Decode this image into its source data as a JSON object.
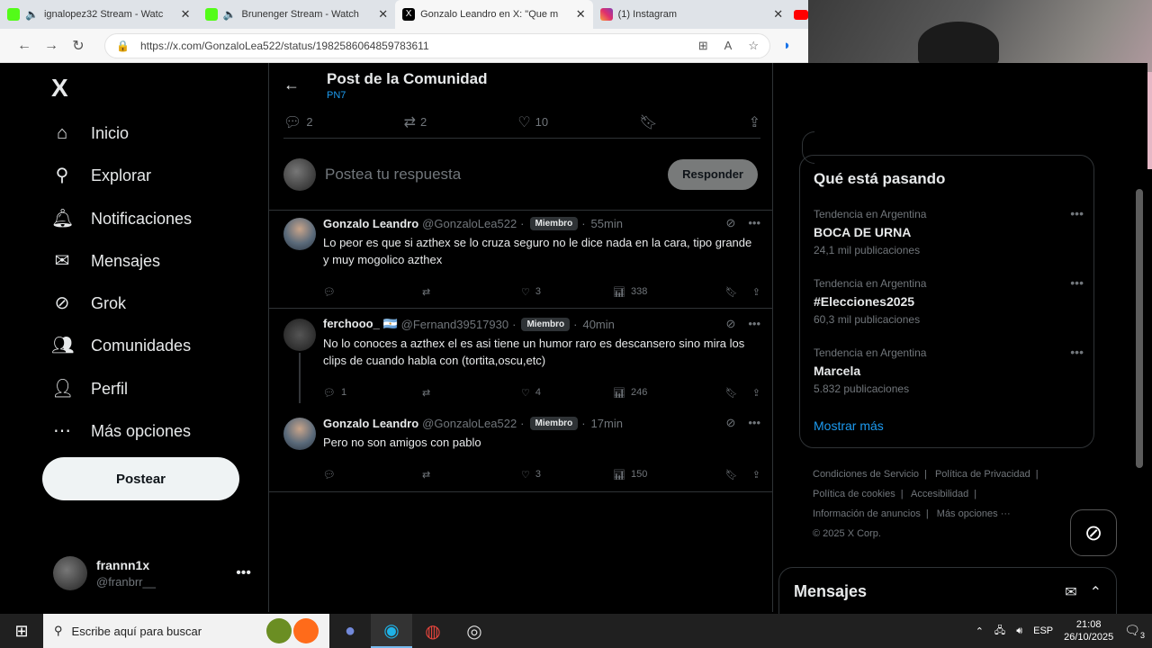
{
  "browser": {
    "tabs": [
      {
        "title": "ignalopez32 Stream - Watc",
        "favicon_color": "#53fc18",
        "muted": true
      },
      {
        "title": "Brunenger Stream - Watch",
        "favicon_color": "#53fc18",
        "muted": true
      },
      {
        "title": "Gonzalo Leandro en X: \"Que m",
        "favicon_color": "#000000",
        "muted": false
      },
      {
        "title": "(1) Instagram",
        "favicon_color": "#e1306c",
        "muted": false
      }
    ],
    "url": "https://x.com/GonzaloLea522/status/1982586064859783611"
  },
  "nav": {
    "logo": "X",
    "items": [
      {
        "label": "Inicio",
        "icon": "home-icon"
      },
      {
        "label": "Explorar",
        "icon": "search-icon"
      },
      {
        "label": "Notificaciones",
        "icon": "bell-icon"
      },
      {
        "label": "Mensajes",
        "icon": "mail-icon"
      },
      {
        "label": "Grok",
        "icon": "grok-icon"
      },
      {
        "label": "Comunidades",
        "icon": "people-icon"
      },
      {
        "label": "Perfil",
        "icon": "person-icon"
      },
      {
        "label": "Más opciones",
        "icon": "more-circle-icon"
      }
    ],
    "post_button": "Postear",
    "profile": {
      "display_name": "frannn1x",
      "handle": "@franbrr__"
    }
  },
  "main": {
    "title": "Post de la Comunidad",
    "subtitle": "PN7",
    "top_actions": {
      "replies": "2",
      "reposts": "2",
      "likes": "10"
    },
    "reply_placeholder": "Postea tu respuesta",
    "reply_button": "Responder",
    "tweets": [
      {
        "name": "Gonzalo Leandro",
        "handle": "@GonzaloLea522",
        "badge": "Miembro",
        "time": "55min",
        "text": "Lo peor es que si azthex se lo cruza seguro no le dice nada en la cara, tipo grande y muy mogolico azthex",
        "replies": "",
        "likes": "3",
        "views": "338"
      },
      {
        "name": "ferchooo_ 🇦🇷",
        "handle": "@Fernand39517930",
        "badge": "Miembro",
        "time": "40min",
        "text": "No lo conoces a azthex el es asi tiene un humor raro es descansero sino mira los clips de cuando habla con (tortita,oscu,etc)",
        "replies": "1",
        "likes": "4",
        "views": "246"
      },
      {
        "name": "Gonzalo Leandro",
        "handle": "@GonzaloLea522",
        "badge": "Miembro",
        "time": "17min",
        "text": "Pero no son amigos con pablo",
        "replies": "",
        "likes": "3",
        "views": "150"
      }
    ]
  },
  "trends": {
    "title": "Qué está pasando",
    "items": [
      {
        "context": "Tendencia en Argentina",
        "name": "BOCA DE URNA",
        "count": "24,1 mil publicaciones"
      },
      {
        "context": "Tendencia en Argentina",
        "name": "#Elecciones2025",
        "count": "60,3 mil publicaciones"
      },
      {
        "context": "Tendencia en Argentina",
        "name": "Marcela",
        "count": "5.832 publicaciones"
      }
    ],
    "show_more": "Mostrar más"
  },
  "footer": {
    "links": [
      "Condiciones de Servicio",
      "Política de Privacidad",
      "Política de cookies",
      "Accesibilidad",
      "Información de anuncios",
      "Más opciones ···"
    ],
    "copyright": "© 2025 X Corp."
  },
  "messages_drawer": {
    "title": "Mensajes"
  },
  "taskbar": {
    "search_placeholder": "Escribe aquí para buscar",
    "language": "ESP",
    "time": "21:08",
    "date": "26/10/2025",
    "notifications": "3"
  }
}
